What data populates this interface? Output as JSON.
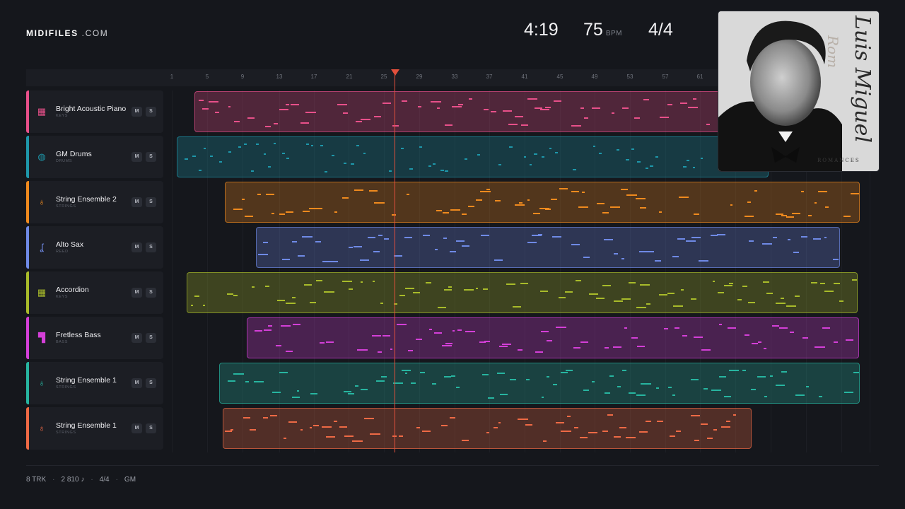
{
  "brand": {
    "name": "MIDIFILES",
    "suffix": ".COM"
  },
  "transport": {
    "time": "4:19",
    "tempo": "75",
    "tempo_unit": "BPM",
    "signature": "4/4"
  },
  "ruler": {
    "bars": [
      "1",
      "5",
      "9",
      "13",
      "17",
      "21",
      "25",
      "29",
      "33",
      "37",
      "41",
      "45",
      "49",
      "53",
      "57",
      "61"
    ]
  },
  "playhead_bar": 26,
  "tracks": [
    {
      "name": "Bright Acoustic Piano",
      "category": "KEYS",
      "icon": "piano-icon",
      "color": "#e8508a",
      "mute": "M",
      "solo": "S"
    },
    {
      "name": "GM Drums",
      "category": "DRUMS",
      "icon": "drum-icon",
      "color": "#1e97aa",
      "mute": "M",
      "solo": "S"
    },
    {
      "name": "String Ensemble 2",
      "category": "STRINGS",
      "icon": "guitar-icon",
      "color": "#ef8a1e",
      "mute": "M",
      "solo": "S"
    },
    {
      "name": "Alto Sax",
      "category": "REED",
      "icon": "saxophone-icon",
      "color": "#6f8ae6",
      "mute": "M",
      "solo": "S"
    },
    {
      "name": "Accordion",
      "category": "KEYS",
      "icon": "piano-icon",
      "color": "#a8bb2a",
      "mute": "M",
      "solo": "S"
    },
    {
      "name": "Fretless Bass",
      "category": "BASS",
      "icon": "bass-icon",
      "color": "#d43fd8",
      "mute": "M",
      "solo": "S"
    },
    {
      "name": "String Ensemble 1",
      "category": "STRINGS",
      "icon": "guitar-icon",
      "color": "#27b5a0",
      "mute": "M",
      "solo": "S"
    },
    {
      "name": "String Ensemble 1",
      "category": "STRINGS",
      "icon": "guitar-icon",
      "color": "#ee6a45",
      "mute": "M",
      "solo": "S"
    }
  ],
  "album": {
    "artist": "Luis Miguel",
    "title": "ROMANCES",
    "script": "Rom"
  },
  "footer": {
    "tracks": "8 TRK",
    "notes": "2 810 ♪",
    "signature": "4/4",
    "standard": "GM"
  }
}
